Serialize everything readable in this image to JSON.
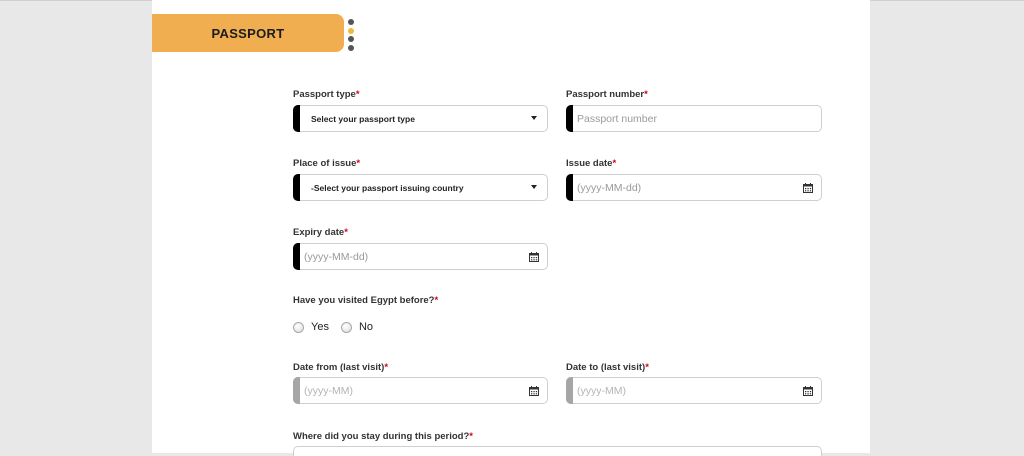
{
  "section": {
    "title": "PASSPORT"
  },
  "fields": {
    "passport_type": {
      "label": "Passport type",
      "value": "Select your passport type"
    },
    "passport_number": {
      "label": "Passport number",
      "placeholder": "Passport number"
    },
    "place_of_issue": {
      "label": "Place of issue",
      "value": "-Select your passport issuing country"
    },
    "issue_date": {
      "label": "Issue date",
      "placeholder": "(yyyy-MM-dd)"
    },
    "expiry_date": {
      "label": "Expiry date",
      "placeholder": "(yyyy-MM-dd)"
    },
    "visited_egypt": {
      "label": "Have you visited Egypt before?",
      "options": [
        "Yes",
        "No"
      ]
    },
    "date_from": {
      "label": "Date from (last visit)",
      "placeholder": "(yyyy-MM)"
    },
    "date_to": {
      "label": "Date to (last visit)",
      "placeholder": "(yyyy-MM)"
    },
    "stay": {
      "label": "Where did you stay during this period?"
    }
  },
  "required_marker": "*",
  "colors": {
    "tab": "#f0ae50",
    "active_dot": "#f1b935",
    "required": "#d0021b"
  }
}
